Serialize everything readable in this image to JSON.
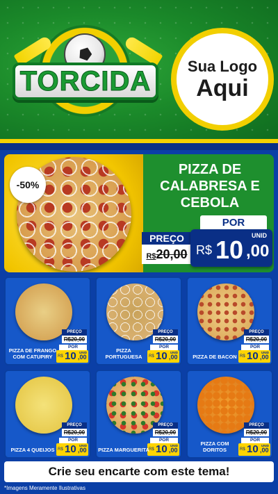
{
  "header": {
    "brand": "TORCIDA",
    "logo_line1": "Sua Logo",
    "logo_line2": "Aqui"
  },
  "featured": {
    "discount": "-50%",
    "title": "PIZZA DE CALABRESA E CEBOLA",
    "preco_label": "PREÇO",
    "old_currency": "R$",
    "old_price": "20,00",
    "por_label": "POR",
    "unit": "UNID",
    "currency": "R$",
    "price_int": "10",
    "price_dec": ",00"
  },
  "products": [
    {
      "name": "PIZZA DE FRANGO COM CATUPIRY",
      "preco_label": "PREÇO",
      "old_price": "R$20,00",
      "por_label": "POR",
      "unit": "UNID",
      "currency": "R$",
      "price_int": "10",
      "price_dec": ",00"
    },
    {
      "name": "PIZZA PORTUGUESA",
      "preco_label": "PREÇO",
      "old_price": "R$20,00",
      "por_label": "POR",
      "unit": "UNID",
      "currency": "R$",
      "price_int": "10",
      "price_dec": ",00"
    },
    {
      "name": "PIZZA DE BACON",
      "preco_label": "PREÇO",
      "old_price": "R$20,00",
      "por_label": "POR",
      "unit": "UNID",
      "currency": "R$",
      "price_int": "10",
      "price_dec": ",00"
    },
    {
      "name": "PIZZA 4 QUEIJOS",
      "preco_label": "PREÇO",
      "old_price": "R$20,00",
      "por_label": "POR",
      "unit": "UNID",
      "currency": "R$",
      "price_int": "10",
      "price_dec": ",00"
    },
    {
      "name": "PIZZA MARGUERITA",
      "preco_label": "PREÇO",
      "old_price": "R$20,00",
      "por_label": "POR",
      "unit": "UNID",
      "currency": "R$",
      "price_int": "10",
      "price_dec": ",00"
    },
    {
      "name": "PIZZA COM DORITOS",
      "preco_label": "PREÇO",
      "old_price": "R$20,00",
      "por_label": "POR",
      "unit": "UNID",
      "currency": "R$",
      "price_int": "10",
      "price_dec": ",00"
    }
  ],
  "footer": {
    "cta": "Crie seu encarte com este tema!",
    "disclaimer": "*Imagens Meramente Ilustrativas"
  },
  "colors": {
    "green": "#1e8f2e",
    "yellow": "#f2cf00",
    "blue": "#0a2f86",
    "card_blue": "#1658c9"
  }
}
